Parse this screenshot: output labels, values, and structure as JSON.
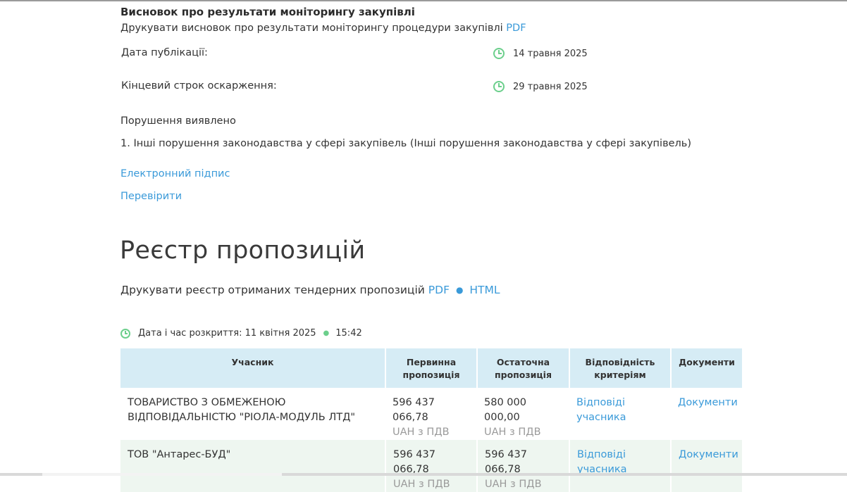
{
  "monitoring": {
    "title": "Висновок про результати моніторингу закупівлі",
    "print_text": "Друкувати висновок про результати моніторингу процедури закупівлі",
    "print_link": "PDF",
    "publication_label": "Дата публікації:",
    "publication_date": "14 травня 2025",
    "appeal_label": "Кінцевий строк оскарження:",
    "appeal_date": "29 травня 2025",
    "violations_title": "Порушення виявлено",
    "violations_item": "1. Інші порушення законодавства у сфері закупівель (Інші порушення законодавства у сфері закупівель)",
    "esign_link": "Електронний підпис",
    "verify_link": "Перевірити"
  },
  "registry": {
    "title": "Реєстр пропозицій",
    "print_text": "Друкувати реєстр отриманих тендерних пропозицій",
    "pdf_link": "PDF",
    "html_link": "HTML",
    "separator": "●",
    "opening_label": "Дата і час розкриття: 11 квітня 2025",
    "opening_sep": "●",
    "opening_time": "15:42",
    "columns": [
      "Учасник",
      "Первинна пропозиція",
      "Остаточна пропозиція",
      "Відповідність критеріям",
      "Документи"
    ],
    "rows": [
      {
        "participant": "ТОВАРИСТВО З ОБМЕЖЕНОЮ ВІДПОВІДАЛЬНІСТЮ \"РІОЛА-МОДУЛЬ ЛТД\"",
        "initial": "596 437 066,78",
        "initial_vat": "UAH з ПДВ",
        "final": "580 000 000,00",
        "final_vat": "UAH з ПДВ",
        "criteria_link": "Відповіді учасника",
        "docs_link": "Документи"
      },
      {
        "participant": "ТОВ \"Антарес-БУД\"",
        "initial": "596 437 066,78",
        "initial_vat": "UAH з ПДВ",
        "final": "596 437 066,78",
        "final_vat": "UAH з ПДВ",
        "criteria_link": "Відповіді учасника",
        "docs_link": "Документи"
      }
    ]
  },
  "colors": {
    "link": "#3a9ad9",
    "clock_icon": "#6ccf8c",
    "table_header_bg": "#d6ecf5",
    "alt_row_bg": "#eef6f0"
  }
}
